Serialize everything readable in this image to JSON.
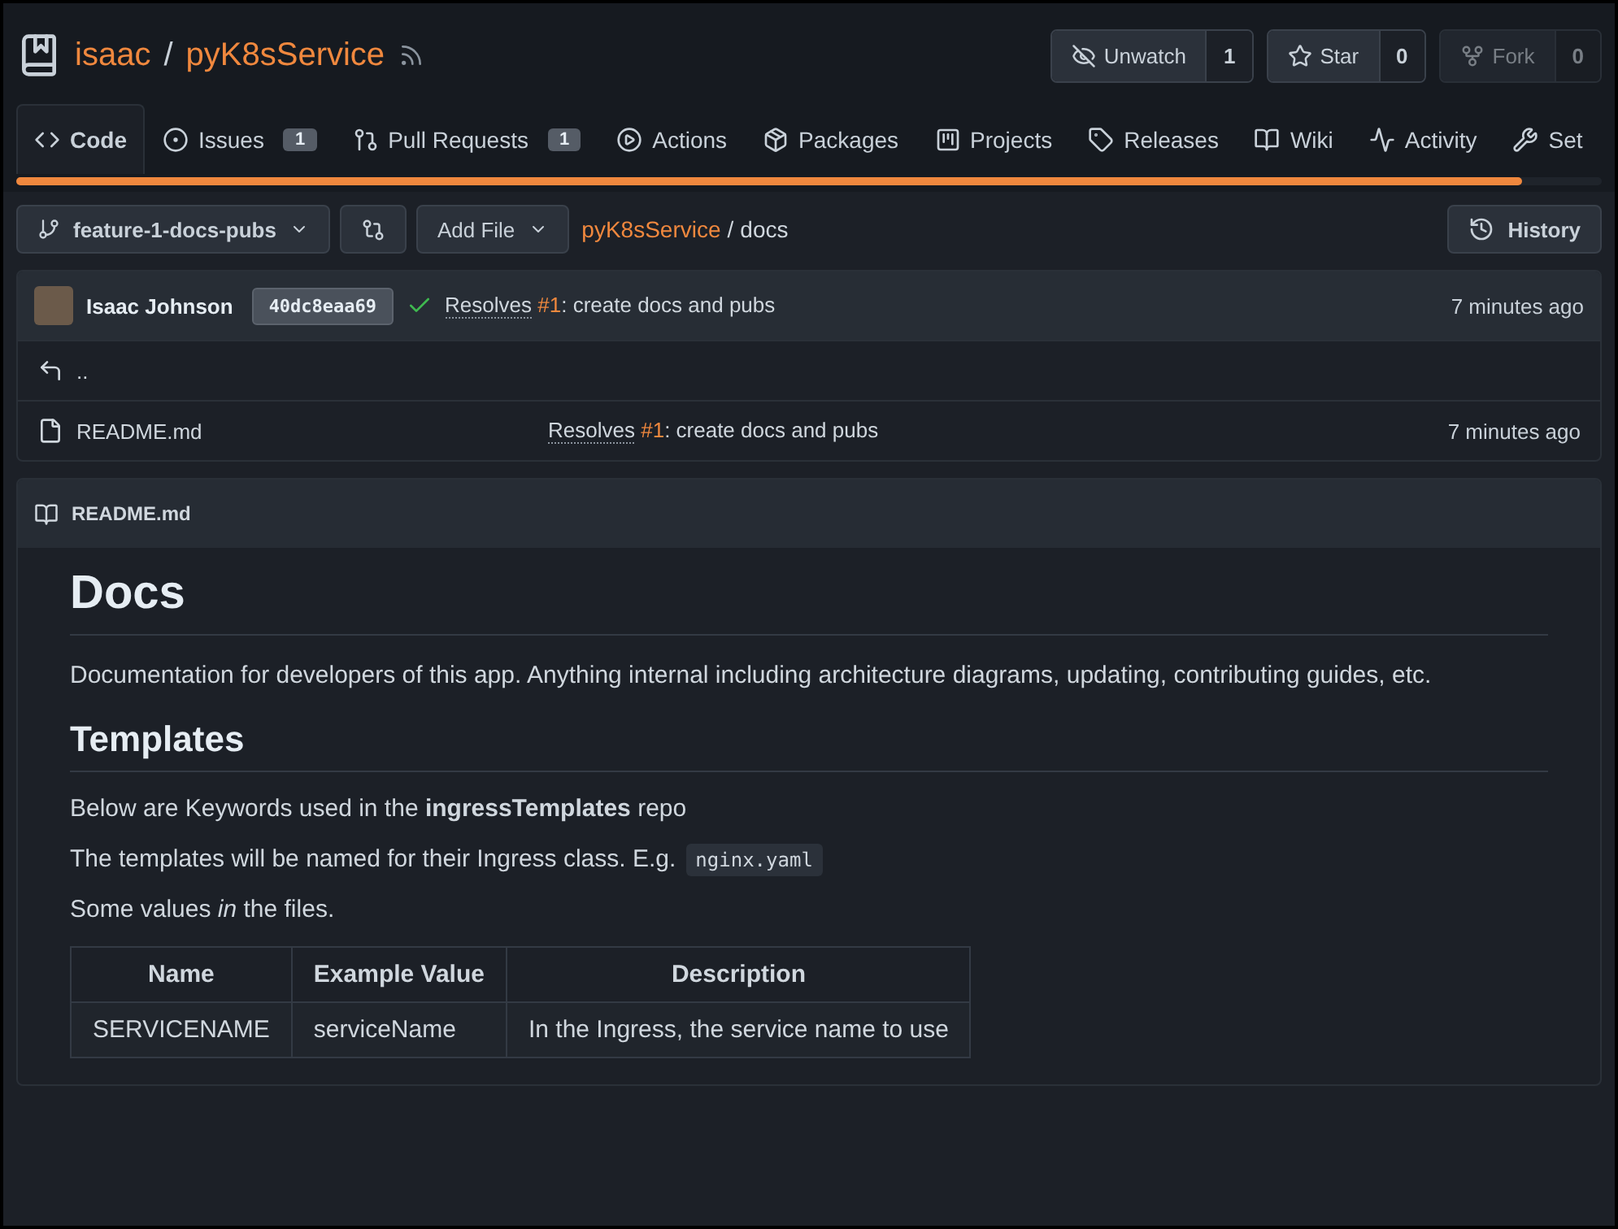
{
  "repo": {
    "owner": "isaac",
    "separator": "/",
    "name": "pyK8sService"
  },
  "actions": [
    {
      "kind": "watch",
      "label": "Unwatch",
      "count": "1",
      "disabled": false
    },
    {
      "kind": "star",
      "label": "Star",
      "count": "0",
      "disabled": false
    },
    {
      "kind": "fork",
      "label": "Fork",
      "count": "0",
      "disabled": true
    }
  ],
  "tabs": [
    {
      "kind": "code",
      "label": "Code",
      "selected": true
    },
    {
      "kind": "issues",
      "label": "Issues",
      "badge": "1",
      "selected": false
    },
    {
      "kind": "pulls",
      "label": "Pull Requests",
      "badge": "1",
      "selected": false
    },
    {
      "kind": "actions",
      "label": "Actions",
      "selected": false
    },
    {
      "kind": "packages",
      "label": "Packages",
      "selected": false
    },
    {
      "kind": "projects",
      "label": "Projects",
      "selected": false
    },
    {
      "kind": "releases",
      "label": "Releases",
      "selected": false
    },
    {
      "kind": "wiki",
      "label": "Wiki",
      "selected": false
    },
    {
      "kind": "activity",
      "label": "Activity",
      "selected": false
    },
    {
      "kind": "settings",
      "label": "Set",
      "selected": false
    }
  ],
  "loading_bar": {
    "level": 0.95
  },
  "toolbar": {
    "branch": "feature-1-docs-pubs",
    "add_file": "Add File",
    "repo_link": "pyK8sService",
    "separator": "/",
    "folder": "docs",
    "history": "History"
  },
  "commit": {
    "author": "Isaac Johnson",
    "sha": "40dc8eaa69",
    "link": "Resolves",
    "issue": "#1",
    "rest": ": create docs and pubs",
    "time": "7 minutes ago"
  },
  "files": [
    {
      "kind": "parent",
      "name": ".."
    },
    {
      "kind": "file",
      "name": "README.md",
      "link": "Resolves",
      "issue": "#1",
      "rest": ": create docs and pubs",
      "time": "7 minutes ago"
    }
  ],
  "readme": {
    "filename": "README.md",
    "blocks": [
      {
        "kind": "h1",
        "text": "Docs"
      },
      {
        "kind": "p",
        "text": "Documentation for developers of this app. Anything internal including architecture diagrams, updating, contributing guides, etc."
      },
      {
        "kind": "h2",
        "text": "Templates"
      },
      {
        "kind": "p",
        "text": "Below are Keywords used in the **ingressTemplates** repo"
      },
      {
        "kind": "p_code",
        "text": "The templates will be named for their Ingress class. E.g.",
        "code": "nginx.yaml"
      },
      {
        "kind": "p",
        "text": "Some values *in* the files."
      },
      {
        "kind": "table",
        "columns": [
          "Name",
          "Example Value",
          "Description"
        ],
        "rows": [
          [
            "SERVICENAME",
            "serviceName",
            "In the Ingress, the service name to use"
          ]
        ]
      }
    ]
  }
}
